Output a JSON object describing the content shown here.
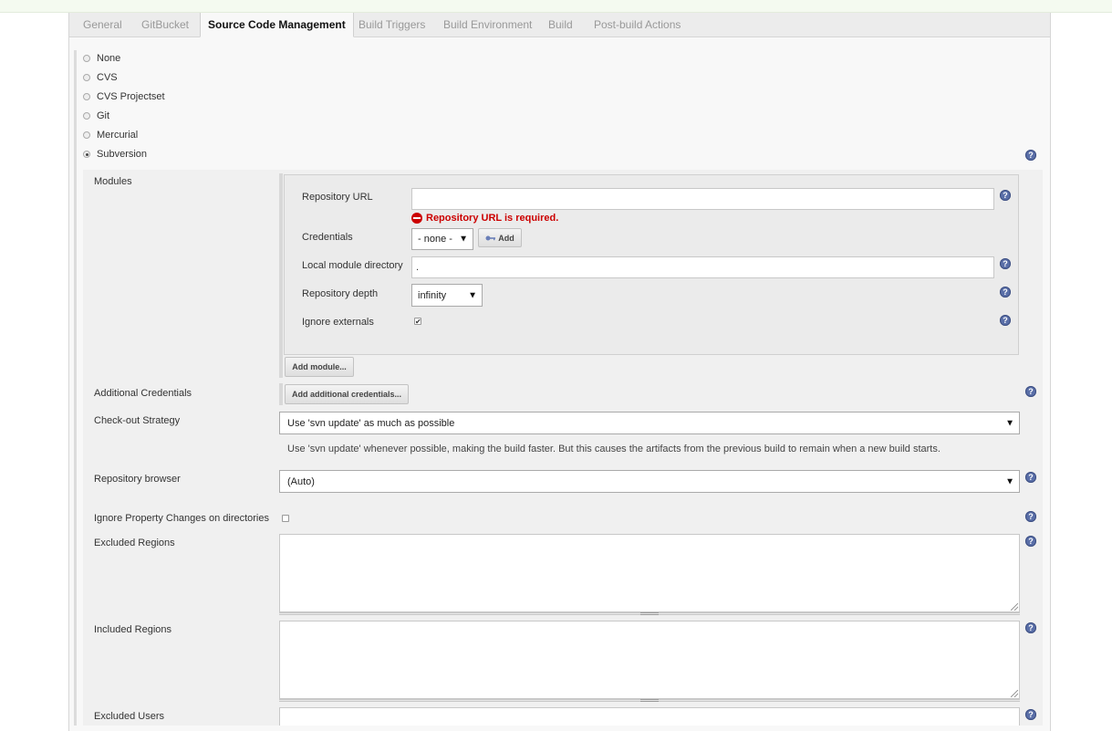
{
  "tabs": [
    "General",
    "GitBucket",
    "Source Code Management",
    "Build Triggers",
    "Build Environment",
    "Build",
    "Post-build Actions"
  ],
  "active_tab": "Source Code Management",
  "scm_options": [
    {
      "label": "None",
      "checked": false
    },
    {
      "label": "CVS",
      "checked": false
    },
    {
      "label": "CVS Projectset",
      "checked": false
    },
    {
      "label": "Git",
      "checked": false
    },
    {
      "label": "Mercurial",
      "checked": false
    },
    {
      "label": "Subversion",
      "checked": true
    }
  ],
  "help_glyph": "?",
  "modules": {
    "label": "Modules",
    "repository_url_label": "Repository URL",
    "repository_url_value": "",
    "repository_url_error": "Repository URL is required.",
    "credentials_label": "Credentials",
    "credentials_value": "- none -",
    "add_button": "Add",
    "local_dir_label": "Local module directory",
    "local_dir_value": ".",
    "depth_label": "Repository depth",
    "depth_value": "infinity",
    "ignore_externals_label": "Ignore externals",
    "ignore_externals_checked": true,
    "add_module_button": "Add module..."
  },
  "additional_credentials": {
    "label": "Additional Credentials",
    "button": "Add additional credentials..."
  },
  "checkout_strategy": {
    "label": "Check-out Strategy",
    "value": "Use 'svn update' as much as possible",
    "description": "Use 'svn update' whenever possible, making the build faster. But this causes the artifacts from the previous build to remain when a new build starts."
  },
  "repository_browser": {
    "label": "Repository browser",
    "value": "(Auto)"
  },
  "ignore_property_changes": {
    "label": "Ignore Property Changes on directories",
    "checked": false
  },
  "excluded_regions": {
    "label": "Excluded Regions",
    "value": ""
  },
  "included_regions": {
    "label": "Included Regions",
    "value": ""
  },
  "excluded_users": {
    "label": "Excluded Users",
    "value": ""
  },
  "glyphs": {
    "dropdown_arrow": "▼",
    "checkmark": "✔"
  },
  "icons": {
    "help": "help-icon",
    "error": "error-icon",
    "key": "key-icon",
    "dropdown": "chevron-down-icon"
  },
  "colors": {
    "error": "#cc0000",
    "help": "#5a6fa8",
    "active_tab_text": "#111111",
    "inactive_tab_text": "#999999"
  }
}
